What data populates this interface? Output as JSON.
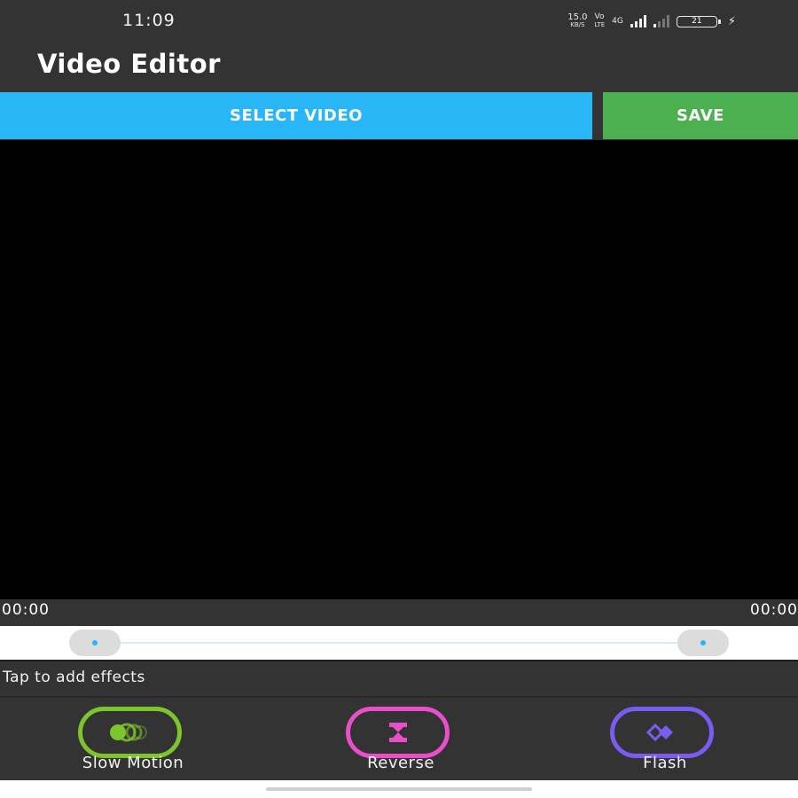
{
  "status_bar": {
    "time": "11:09",
    "speed_value": "15.0",
    "speed_unit": "KB/S",
    "network_label": "Vo",
    "network_sub": "LTE",
    "network_type": "4G",
    "battery_level": "21",
    "icons": [
      "signal-icon",
      "wifi-icon",
      "battery-icon",
      "charging-icon"
    ]
  },
  "app_bar": {
    "title": "Video Editor"
  },
  "actions": {
    "select_video_label": "SELECT VIDEO",
    "save_label": "SAVE",
    "select_color": "#29b6f6",
    "save_color": "#4caf50"
  },
  "player": {
    "current_time": "00:00",
    "total_time": "00:00",
    "seek_start_fraction": 0,
    "seek_end_fraction": 1
  },
  "effects": {
    "hint": "Tap to add effects",
    "items": [
      {
        "label": "Slow Motion",
        "icon": "slow-motion-icon",
        "color": "#7dc52d"
      },
      {
        "label": "Reverse",
        "icon": "reverse-icon",
        "color": "#e84fc8"
      },
      {
        "label": "Flash",
        "icon": "flash-icon",
        "color": "#7b5cf0"
      }
    ]
  }
}
